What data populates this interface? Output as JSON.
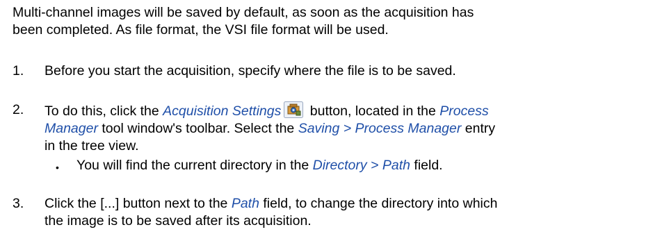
{
  "intro": {
    "line1": "Multi-channel images will be saved by default, as soon as the acquisition has",
    "line2": "been completed. As file format, the VSI file format will be used."
  },
  "steps": [
    {
      "number": "1.",
      "line1": "Before you start the acquisition, specify where the file is to be saved."
    },
    {
      "number": "2.",
      "t1": "To do this, click the ",
      "ui1": "Acquisition Settings",
      "icon": "acquisition-settings-icon",
      "t2": " button, located in the ",
      "ui2a": "Process",
      "ui2b": "Manager",
      "t3": " tool window's toolbar. Select the ",
      "ui3": "Saving > Process Manager",
      "t4": " entry",
      "t5": "in the tree view.",
      "sub": {
        "bullet": "•",
        "t1": "You will find the current directory in the ",
        "ui1": "Directory > Path",
        "t2": "  field."
      }
    },
    {
      "number": "3.",
      "t1": "Click the [...] button next to the ",
      "ui1": "Path",
      "t2": " field, to change the directory into which",
      "t3": "the image is to be saved after its acquisition."
    }
  ],
  "colors": {
    "ui_term": "#1f4fa8",
    "text": "#000000"
  }
}
